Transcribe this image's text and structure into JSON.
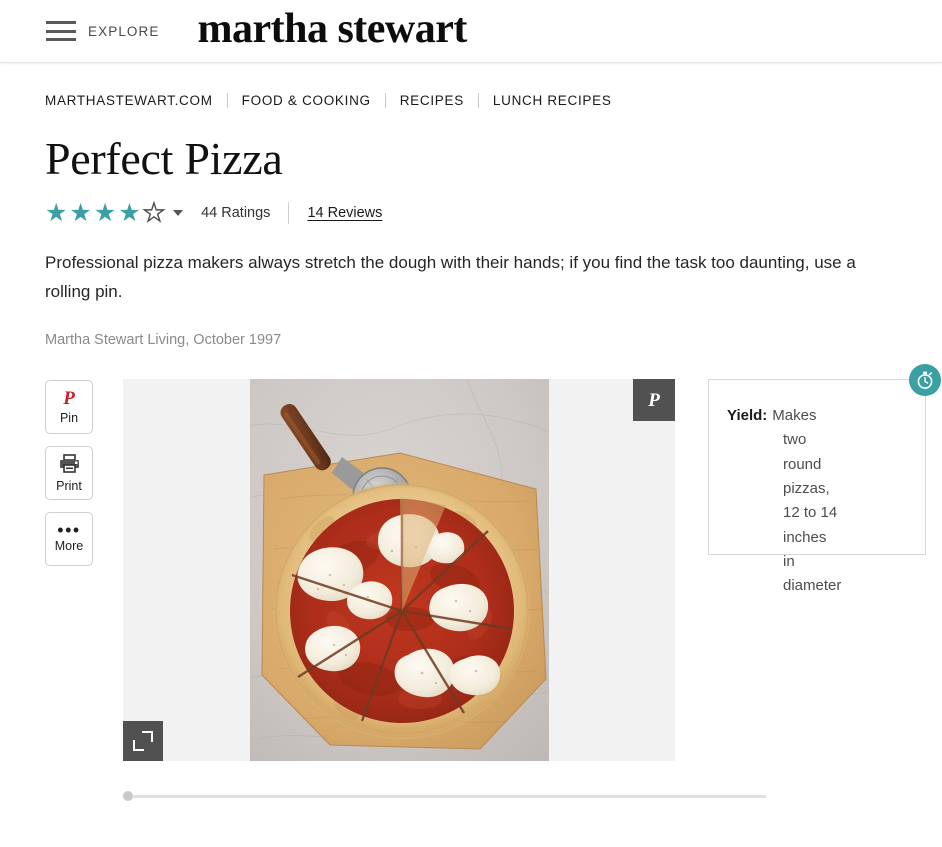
{
  "header": {
    "menu_icon": "hamburger-icon",
    "explore_label": "EXPLORE",
    "brand": "martha stewart"
  },
  "breadcrumb": {
    "items": [
      {
        "label": "MARTHASTEWART.COM"
      },
      {
        "label": "FOOD & COOKING"
      },
      {
        "label": "RECIPES"
      },
      {
        "label": "LUNCH RECIPES"
      }
    ]
  },
  "recipe": {
    "title": "Perfect Pizza",
    "rating": {
      "stars_filled": 4,
      "stars_total": 5,
      "star_color": "#3AA0A4",
      "ratings_label": "44 Ratings",
      "reviews_label": "14 Reviews"
    },
    "description": "Professional pizza makers always stretch the dough with their hands; if you find the task too daunting, use a rolling pin.",
    "attribution": "Martha Stewart Living, October 1997"
  },
  "actions": [
    {
      "name": "pin",
      "icon": "pinterest-icon",
      "glyph": "P",
      "label": "Pin",
      "color": "#CB1F27"
    },
    {
      "name": "print",
      "icon": "printer-icon",
      "label": "Print"
    },
    {
      "name": "more",
      "icon": "ellipsis-icon",
      "glyph": "•••",
      "label": "More"
    }
  ],
  "media": {
    "pin_save_icon": "pinterest-icon",
    "expand_icon": "expand-icon",
    "alt": "Sliced margherita pizza on a wooden board with a pizza cutter",
    "background": "#f2f2f2"
  },
  "yield_card": {
    "label": "Yield:",
    "value": "Makes two round pizzas, 12 to 14 inches in diameter",
    "badge_icon": "stopwatch-icon",
    "badge_color": "#3AA0A4"
  }
}
